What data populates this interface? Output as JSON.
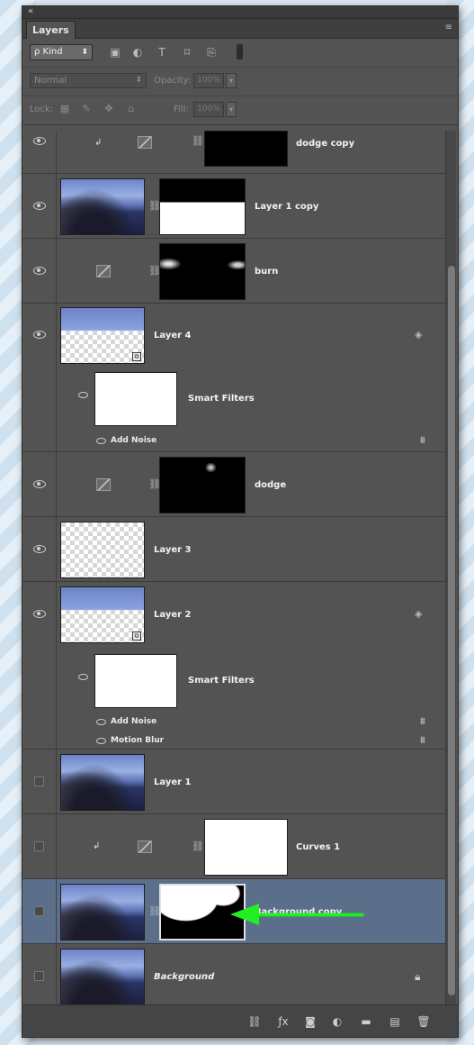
{
  "panel": {
    "tab_label": "Layers",
    "collapse_glyph": "«",
    "menu_glyph": "≡"
  },
  "filter_bar": {
    "kind_label": "ρ Kind",
    "kind_arrow": "⬍",
    "icons": [
      "image-filter-icon",
      "adjustment-filter-icon",
      "type-filter-icon",
      "shape-filter-icon",
      "smart-object-filter-icon"
    ]
  },
  "blend": {
    "mode": "Normal",
    "opacity_label": "Opacity:",
    "opacity_value": "100%"
  },
  "lock": {
    "lock_label": "Lock:",
    "fill_label": "Fill:",
    "fill_value": "100%"
  },
  "layers": [
    {
      "name": "dodge copy",
      "type": "adjustment"
    },
    {
      "name": "Layer 1 copy",
      "type": "photo"
    },
    {
      "name": "burn",
      "type": "adjustment"
    },
    {
      "name": "Layer 4",
      "type": "smart",
      "smart_filters_label": "Smart Filters",
      "filters": [
        "Add Noise"
      ]
    },
    {
      "name": "dodge",
      "type": "adjustment"
    },
    {
      "name": "Layer 3",
      "type": "pixel"
    },
    {
      "name": "Layer 2",
      "type": "smart",
      "smart_filters_label": "Smart Filters",
      "filters": [
        "Add Noise",
        "Motion Blur"
      ]
    },
    {
      "name": "Layer 1",
      "type": "photo"
    },
    {
      "name": "Curves 1",
      "type": "curves"
    },
    {
      "name": "Background copy",
      "type": "photo-mask",
      "selected": true
    },
    {
      "name": "Background",
      "type": "background",
      "locked": true
    }
  ],
  "bottom_icons": [
    "link-icon",
    "fx-icon",
    "add-mask-icon",
    "new-adjustment-icon",
    "new-group-icon",
    "new-layer-icon",
    "delete-icon"
  ],
  "accent_colors": {
    "selection": "#5b6f8b",
    "annotation_arrow": "#22ee22"
  }
}
